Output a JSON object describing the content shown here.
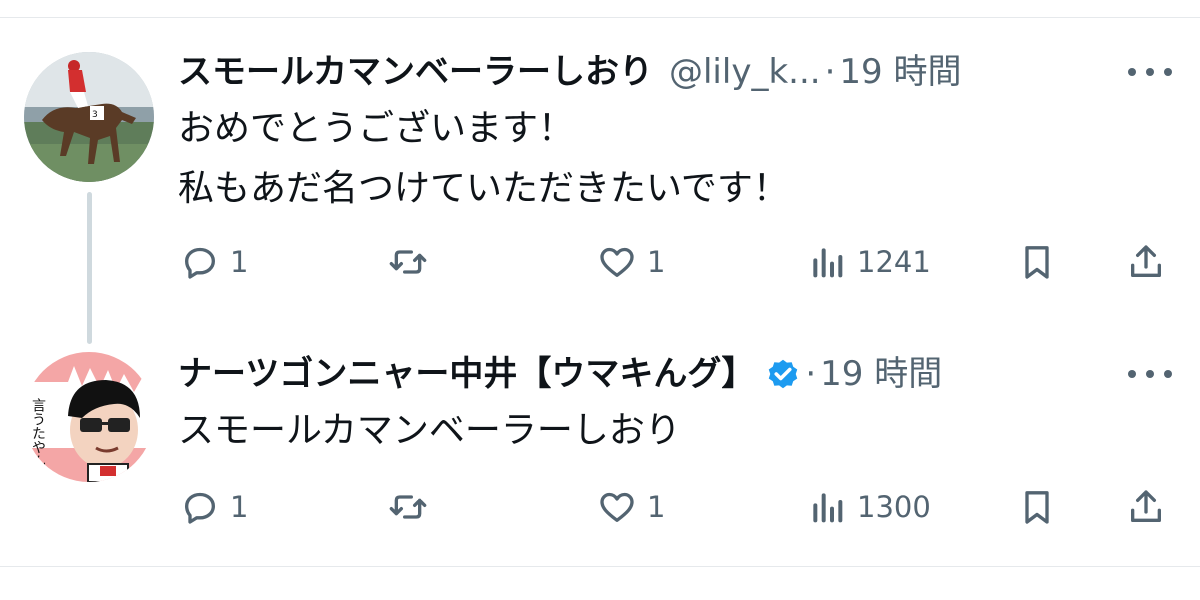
{
  "tweets": [
    {
      "name": "スモールカマンベーラーしおり",
      "handle": "@lily_k...",
      "separator": "·",
      "time": "19 時間",
      "text_lines": [
        "おめでとうございます！",
        "私もあだ名つけていただきたいです！"
      ],
      "avatar_icon": "horse-racing-avatar",
      "verified": false,
      "actions": {
        "reply_count": "1",
        "retweet_count": "",
        "like_count": "1",
        "views_count": "1241"
      }
    },
    {
      "name": "ナーツゴンニャー中井【ウマキんグ】",
      "handle": "",
      "separator": "·",
      "time": "19 時間",
      "text_lines": [
        "スモールカマンベーラーしおり"
      ],
      "avatar_icon": "cartoon-man-avatar",
      "avatar_caption": "言うたやん。",
      "verified": true,
      "actions": {
        "reply_count": "1",
        "retweet_count": "",
        "like_count": "1",
        "views_count": "1300"
      }
    }
  ],
  "colors": {
    "text_primary": "#0f1419",
    "text_secondary": "#536471",
    "verified_blue": "#1d9bf0",
    "thread_line": "#cfd9de",
    "divider": "#e6e9ec"
  },
  "icons": {
    "reply": "speech-bubble-icon",
    "retweet": "retweet-arrows-icon",
    "like": "heart-icon",
    "views": "bar-chart-icon",
    "bookmark": "bookmark-icon",
    "share": "share-upload-icon",
    "more": "more-dots-icon"
  }
}
